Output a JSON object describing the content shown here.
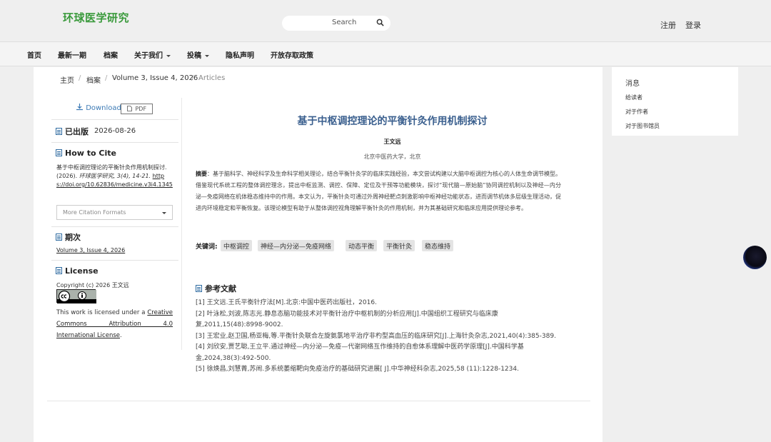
{
  "header": {
    "logo": "环球医学研究",
    "search_label": "Search",
    "register": "注册",
    "login": "登录"
  },
  "nav": {
    "items": [
      "首页",
      "最新一期",
      "档案",
      "关于我们",
      "投稿",
      "隐私声明",
      "开放存取政策"
    ]
  },
  "breadcrumb": {
    "home": "主页",
    "archive": "档案",
    "issue": "Volume 3, Issue 4, 2026",
    "current": "Articles"
  },
  "sidebar": {
    "download": "Download",
    "pdf": "PDF",
    "published_label": "已出版",
    "published_date": "2026-08-26",
    "cite_label": "How to Cite",
    "cite_text": "基于中枢调控理论的平衡针灸作用机制探讨. (2026).",
    "cite_journal": "环球医学研究",
    "cite_tail": ", 3(4), 14-21.",
    "cite_doi": "https://doi.org/10.62836/medicine.v3i4.1345",
    "cite_select": "More Citation Formats",
    "issue_label": "期次",
    "issue_link": "Volume 3, Issue 4, 2026",
    "license_label": "License",
    "license_copyright": "Copyright (c) 2026 王文远",
    "license_body_pre": "This work is licensed under a ",
    "license_link": "Creative Commons Attribution 4.0 International License",
    "license_body_post": "."
  },
  "article": {
    "title": "基于中枢调控理论的平衡针灸作用机制探讨",
    "author": "王文远",
    "affiliation": "北京中医药大学，北京",
    "abstract_label": "摘要",
    "abstract": "：基于脑科学、神经科学及生命科学相关理论，结合平衡针灸学的临床实践经验，本文尝试构建以大脑中枢调控为核心的人体生命调节模型。借鉴现代系统工程的整体调控理念，提出中枢监测、调控、保障、定位及干预等功能模块，探讨“现代脑—原始脑”协同调控机制以及神经—内分泌—免疫网络在机体稳态维持中的作用。本文认为，平衡针灸可通过外周神经靶点刺激影响中枢神经功能状态，进而调节机体多层级生理活动，促进内环境稳定和平衡恢复。该理论模型有助于从整体调控视角理解平衡针灸的作用机制，并为其基础研究和临床应用提供理论参考。",
    "keywords_label": "关键词:",
    "keywords": [
      "中枢调控",
      "神经—内分泌—免疫网络",
      "动态平衡",
      "平衡针灸",
      "稳态维持"
    ],
    "references_label": "参考文献",
    "references": [
      "[1] 王文远.王氏平衡针疗法[M].北京:中国中医药出版社，2016.",
      "[2] 叶泳松,刘波,陈志光.静息态脑功能技术对平衡针治疗中枢机制的分析应用[J].中国组织工程研究与临床康复,2011,15(48):8998-9002.",
      "[3] 王宏业,赵卫国,杨亚梅,等.平衡针灸联合左旋氨氯地平治疗非杓型高血压的临床研究[J].上海针灸杂志,2021,40(4):385-389.",
      "[4] 刘欣安,贾艺聪,王立平.通过神经—内分泌—免疫—代谢网络互作维持的自愈体系理解中医药学原理[J].中国科学基金,2024,38(3):492-500.",
      "[5] 徐焕昌,刘慧菁,苏闹.多系统萎缩靶向免疫治疗的基础研究进展[ J].中华神经科杂志,2025,58 (11):1228-1234."
    ]
  },
  "right_panel": {
    "title": "消息",
    "links": [
      "给读者",
      "对于作者",
      "对于图书馆员"
    ]
  },
  "colors": {
    "logo": "#3a9a3c",
    "title": "#3a5f8e",
    "link": "#3c7ab5"
  }
}
